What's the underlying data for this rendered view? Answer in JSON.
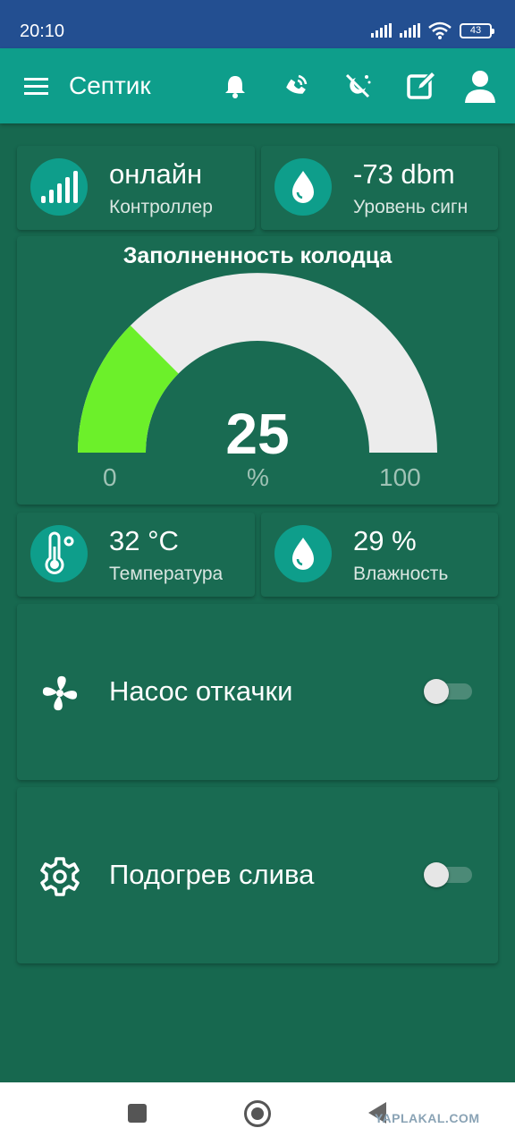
{
  "status_bar": {
    "time": "20:10",
    "battery": "43",
    "icons": [
      "signal-icon",
      "signal-icon",
      "wifi-icon",
      "battery-icon"
    ]
  },
  "app_bar": {
    "title": "Септик",
    "actions": [
      "bell-icon",
      "phone-icon",
      "weather-icon",
      "edit-icon",
      "account-icon"
    ]
  },
  "widgets": {
    "controller": {
      "value": "онлайн",
      "label": "Контроллер",
      "icon": "signal-bars-icon"
    },
    "signal": {
      "value": "-73 dbm",
      "label": "Уровень сигн",
      "icon": "water-drop-icon"
    },
    "fill_gauge": {
      "title": "Заполненность колодца",
      "value": 25,
      "value_text": "25",
      "unit": "%",
      "min": "0",
      "max": "100"
    },
    "temperature": {
      "value": "32 °C",
      "label": "Температура",
      "icon": "thermometer-icon"
    },
    "humidity": {
      "value": "29 %",
      "label": "Влажность",
      "icon": "water-drop-icon"
    },
    "pump": {
      "label": "Насос откачки",
      "icon": "fan-icon",
      "on": false
    },
    "heating": {
      "label": "Подогрев слива",
      "icon": "gear-icon",
      "on": false
    }
  },
  "colors": {
    "status_bar": "#234f91",
    "app_bar": "#0e9e8b",
    "background": "#17684f",
    "card": "#196b52",
    "gauge_fill": "#6cf02a",
    "gauge_track": "#ececec"
  },
  "nav_bar": {
    "buttons": [
      "recents-button",
      "home-button",
      "back-button"
    ],
    "watermark": "YAPLAKAL.COM"
  }
}
